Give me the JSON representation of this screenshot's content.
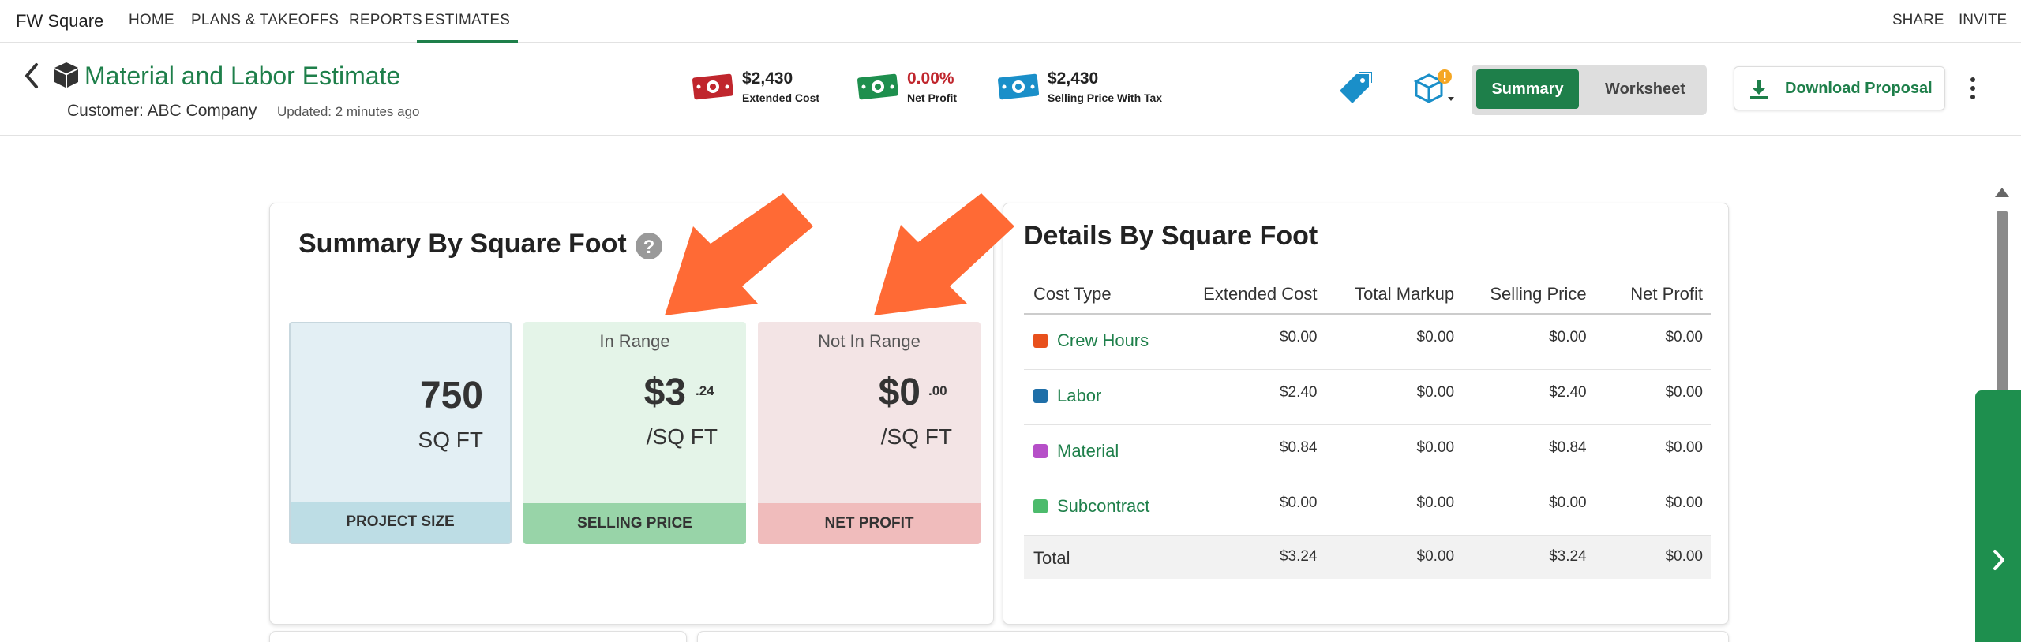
{
  "nav": {
    "brand": "FW Square",
    "items": [
      "HOME",
      "PLANS & TAKEOFFS",
      "REPORTS",
      "ESTIMATES"
    ],
    "active": "ESTIMATES",
    "right": [
      "SHARE",
      "INVITE"
    ]
  },
  "header": {
    "title": "Material and Labor Estimate",
    "customer": "Customer: ABC Company",
    "updated": "Updated: 2 minutes ago",
    "metrics": [
      {
        "value": "$2,430",
        "label": "Extended Cost",
        "icon": "money-icon",
        "color": "#c0262d"
      },
      {
        "value": "0.00%",
        "label": "Net Profit",
        "icon": "money-icon",
        "color": "#1e8f4e"
      },
      {
        "value": "$2,430",
        "label": "Selling Price With Tax",
        "icon": "money-icon",
        "color": "#1a8fc9"
      }
    ],
    "summary_label": "Summary",
    "worksheet_label": "Worksheet",
    "download_label": "Download Proposal"
  },
  "summary": {
    "title": "Summary By Square Foot",
    "cards": {
      "size": {
        "big": "750",
        "unit": "SQ FT",
        "foot": "PROJECT SIZE"
      },
      "sell": {
        "range": "In Range",
        "big": "$3",
        "cents": ".24",
        "unit": "/SQ FT",
        "foot": "SELLING PRICE"
      },
      "net": {
        "range": "Not In Range",
        "big": "$0",
        "cents": ".00",
        "unit": "/SQ FT",
        "foot": "NET PROFIT"
      }
    }
  },
  "details": {
    "title": "Details By Square Foot",
    "columns": [
      "Cost Type",
      "Extended Cost",
      "Total Markup",
      "Selling Price",
      "Net Profit"
    ],
    "rows": [
      {
        "name": "Crew Hours",
        "color": "#e8501c",
        "ext": "$0.00",
        "markup": "$0.00",
        "sell": "$0.00",
        "net": "$0.00"
      },
      {
        "name": "Labor",
        "color": "#1f6fa8",
        "ext": "$2.40",
        "markup": "$0.00",
        "sell": "$2.40",
        "net": "$0.00"
      },
      {
        "name": "Material",
        "color": "#b64fc8",
        "ext": "$0.84",
        "markup": "$0.00",
        "sell": "$0.84",
        "net": "$0.00"
      },
      {
        "name": "Subcontract",
        "color": "#4cbb6c",
        "ext": "$0.00",
        "markup": "$0.00",
        "sell": "$0.00",
        "net": "$0.00"
      }
    ],
    "total": {
      "name": "Total",
      "ext": "$3.24",
      "markup": "$0.00",
      "sell": "$3.24",
      "net": "$0.00"
    }
  },
  "colors": {
    "accent": "#1e7f4a",
    "arrow": "#ff6a35"
  }
}
